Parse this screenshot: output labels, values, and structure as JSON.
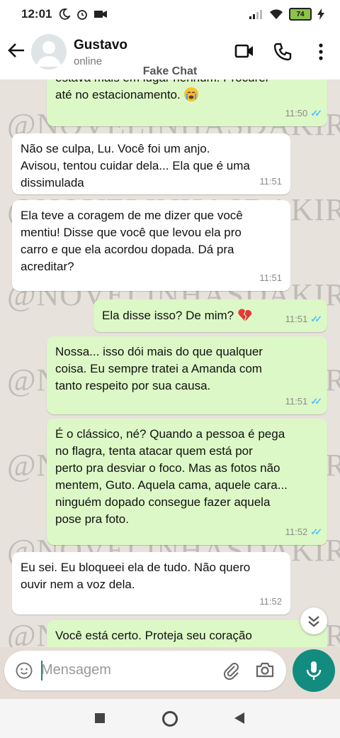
{
  "status_bar": {
    "time": "12:01",
    "battery": "74"
  },
  "header": {
    "contact_name": "Gustavo",
    "contact_status": "online"
  },
  "overlay": {
    "fake_chat": "Fake Chat"
  },
  "watermark": {
    "text": "@NOVELINHASDAKIRA"
  },
  "messages": [
    {
      "lines": [
        "estava mais em lugar nenhum. Procurei",
        "até no estacionamento."
      ],
      "emoji": "crying-emoji",
      "time": "11:50",
      "direction": "out",
      "read": true
    },
    {
      "lines": [
        "Não se culpa, Lu. Você foi um anjo.",
        "Avisou, tentou cuidar dela... Ela que é uma",
        "dissimulada"
      ],
      "time": "11:51",
      "direction": "in"
    },
    {
      "lines": [
        "Ela teve a coragem de me dizer que você",
        "mentiu! Disse que você que levou ela pro",
        "carro e que ela acordou dopada. Dá pra",
        "acreditar?"
      ],
      "time": "11:51",
      "direction": "in"
    },
    {
      "lines": [
        "Ela disse isso? De mim?"
      ],
      "emoji": "broken-heart-emoji",
      "time": "11:51",
      "direction": "out",
      "read": true
    },
    {
      "lines": [
        "Nossa... isso dói mais do que qualquer",
        "coisa. Eu sempre tratei a Amanda com",
        "tanto respeito por sua causa."
      ],
      "time": "11:51",
      "direction": "out",
      "read": true
    },
    {
      "lines": [
        "É o clássico, né? Quando a pessoa é pega",
        "no flagra, tenta atacar quem está por",
        "perto pra desviar o foco. Mas as fotos não",
        "mentem, Guto. Aquela cama, aquele cara...",
        "ninguém dopado consegue fazer aquela",
        "pose pra foto."
      ],
      "time": "11:52",
      "direction": "out",
      "read": true
    },
    {
      "lines": [
        "Eu sei. Eu bloqueei ela de tudo. Não quero",
        "ouvir nem a voz dela."
      ],
      "time": "11:52",
      "direction": "in"
    },
    {
      "lines": [
        "Você está certo. Proteja seu coração"
      ],
      "time": "",
      "direction": "out",
      "read": false
    }
  ],
  "input": {
    "placeholder": "Mensagem"
  },
  "colors": {
    "accent": "#128c7e",
    "outgoing_bubble": "#dcf8c6",
    "incoming_bubble": "#ffffff",
    "read_ticks": "#4fc3f7"
  }
}
